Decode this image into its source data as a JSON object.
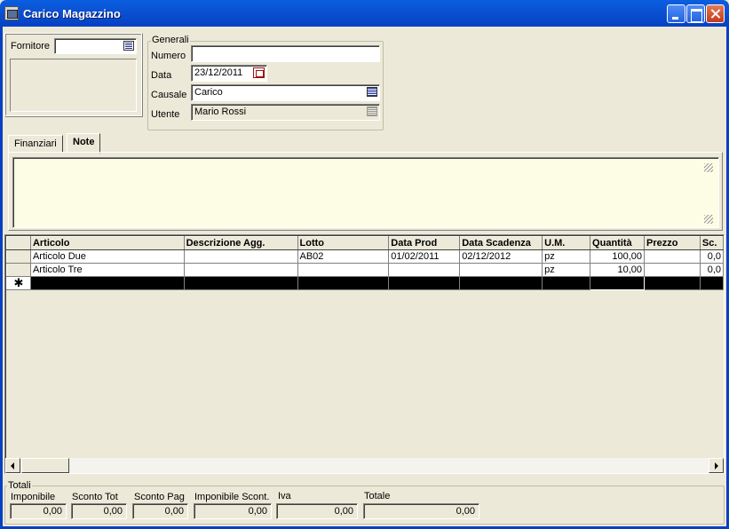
{
  "window": {
    "title": "Carico Magazzino"
  },
  "fornitore": {
    "label": "Fornitore",
    "value": ""
  },
  "generali": {
    "group_label": "Generali",
    "numero_label": "Numero",
    "numero_value": "",
    "data_label": "Data",
    "data_value": "23/12/2011",
    "causale_label": "Causale",
    "causale_value": "Carico",
    "utente_label": "Utente",
    "utente_value": "Mario Rossi"
  },
  "tabs": [
    {
      "label": "Finanziari",
      "active": false
    },
    {
      "label": "Note",
      "active": true
    }
  ],
  "notes": {
    "value": ""
  },
  "grid": {
    "columns": [
      "Articolo",
      "Descrizione Agg.",
      "Lotto",
      "Data Prod",
      "Data Scadenza",
      "U.M.",
      "Quantità",
      "Prezzo",
      "Sc."
    ],
    "rows": [
      [
        "Articolo Due",
        "",
        "AB02",
        "01/02/2011",
        "02/12/2012",
        "pz",
        "100,00",
        "",
        "0,0"
      ],
      [
        "Articolo Tre",
        "",
        "",
        "",
        "",
        "pz",
        "10,00",
        "",
        "0,0"
      ]
    ],
    "new_row_marker": "✱"
  },
  "totali": {
    "label": "Totali",
    "fields": [
      {
        "label": "Imponibile",
        "value": "0,00"
      },
      {
        "label": "Sconto Tot",
        "value": "0,00"
      },
      {
        "label": "Sconto Pag",
        "value": "0,00"
      },
      {
        "label": "Imponibile Scont.",
        "value": "0,00"
      },
      {
        "label": "Iva",
        "value": "0,00"
      },
      {
        "label": "Totale",
        "value": "0,00"
      }
    ]
  },
  "colors": {
    "titlebar": "#0a4fd0",
    "window_bg": "#ece9d8",
    "memo_bg": "#fdfde6",
    "close_button": "#c23a18"
  },
  "icons": [
    "app-icon",
    "minimize-icon",
    "maximize-icon",
    "close-icon",
    "dropdown-icon",
    "calendar-icon",
    "scroll-left-icon",
    "scroll-right-icon"
  ]
}
